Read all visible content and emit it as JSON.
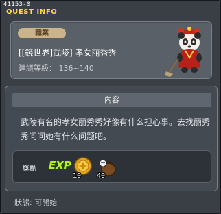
{
  "window": {
    "quest_id": "41153-0",
    "title": "QUEST INFO"
  },
  "header": {
    "job_badge": "職業",
    "quest_title": "[[鏡世界]武陵] 孝女丽秀秀",
    "level_requirement": "建議等級： 136~140",
    "npc_icon": "panda-npc-icon"
  },
  "content": {
    "heading": "內容",
    "description": "武陵有名的孝女丽秀秀好像有什么担心事。去找丽秀秀问问她有什么问题吧。"
  },
  "rewards": {
    "label": "獎勵",
    "exp_label": "EXP",
    "items": [
      {
        "icon": "gold-coin-icon",
        "count": "10"
      },
      {
        "icon": "item-bag-icon",
        "count": "40"
      }
    ]
  },
  "status": {
    "text": "狀態:  可開始"
  },
  "colors": {
    "title_yellow": "#ffd84a",
    "exp_green": "#b6f01e",
    "badge_tan": "#c9b48c"
  }
}
